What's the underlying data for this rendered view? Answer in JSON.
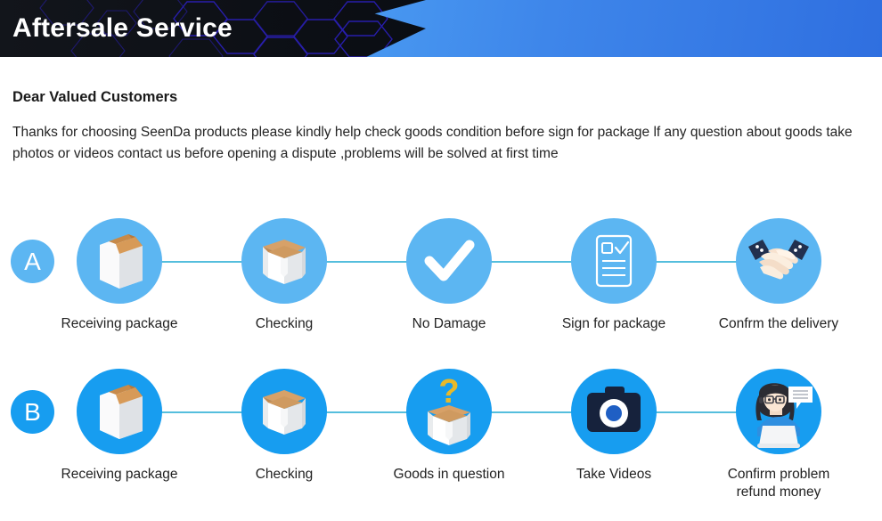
{
  "banner": {
    "title": "Aftersale Service",
    "dark_color": "#0d1016",
    "hex_outline_color": "#2a1fb4",
    "blue_start": "#4aa8f7",
    "blue_end": "#2f6fe0"
  },
  "intro": {
    "salutation": "Dear Valued Customers",
    "paragraph": "Thanks for choosing SeenDa products please kindly help check goods condition before sign for package lf any question about goods take photos or videos contact us before opening a dispute ,problems will be solved at first time"
  },
  "colors": {
    "circle_light": "#5cb6f2",
    "circle_strong": "#179df0",
    "connector": "#55bedd",
    "label_text": "#222222",
    "question_mark": "#e8b92a",
    "box_tan": "#d9a066",
    "sleeve_navy": "#22304e"
  },
  "rows": [
    {
      "badge": "A",
      "badge_name": "row-badge-a",
      "steps": [
        {
          "label": "Receiving package",
          "icon": "closed-box-icon"
        },
        {
          "label": "Checking",
          "icon": "open-box-icon"
        },
        {
          "label": "No Damage",
          "icon": "checkmark-icon"
        },
        {
          "label": "Sign for package",
          "icon": "signed-document-icon"
        },
        {
          "label": "Confrm the delivery",
          "icon": "handshake-icon"
        }
      ]
    },
    {
      "badge": "B",
      "badge_name": "row-badge-b",
      "steps": [
        {
          "label": "Receiving package",
          "icon": "closed-box-icon"
        },
        {
          "label": "Checking",
          "icon": "open-box-icon"
        },
        {
          "label": "Goods in question",
          "icon": "question-box-icon"
        },
        {
          "label": "Take Videos",
          "icon": "camera-icon"
        },
        {
          "label": "Confirm problem\nrefund money",
          "icon": "support-agent-icon"
        }
      ]
    }
  ]
}
